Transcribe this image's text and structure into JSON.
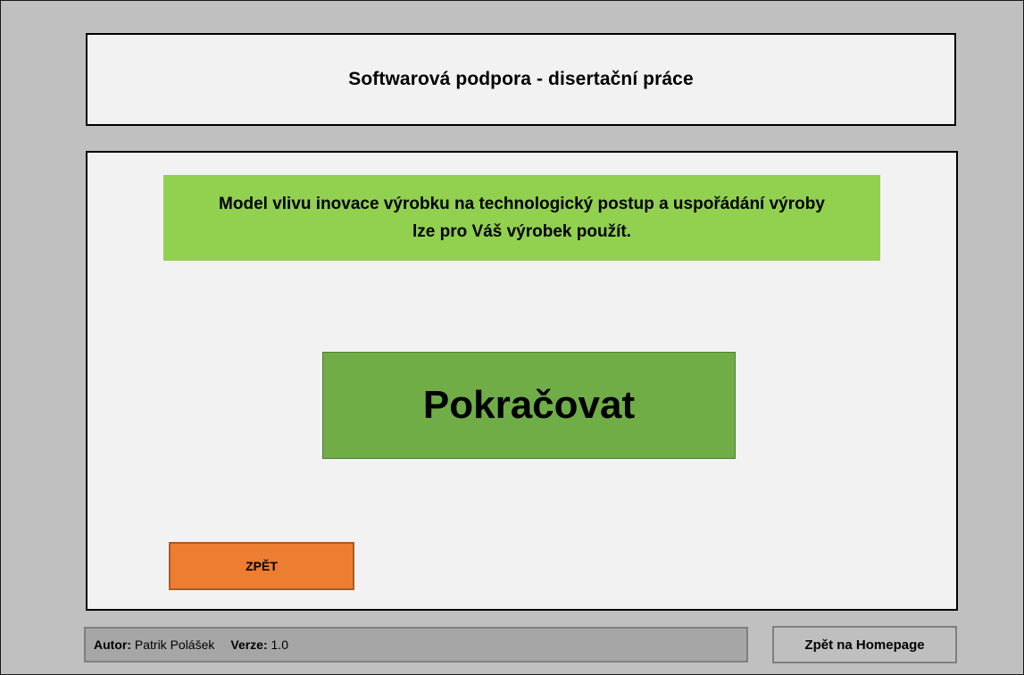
{
  "header": {
    "title": "Softwarová podpora - disertační práce"
  },
  "main": {
    "message_line_1": "Model vlivu inovace výrobku na technologický postup a uspořádání výroby",
    "message_line_2": "lze pro Váš výrobek použít.",
    "continue_label": "Pokračovat",
    "back_label": "ZPĚT"
  },
  "footer": {
    "author_key": "Autor:",
    "author_value": "Patrik Polášek",
    "version_key": "Verze:",
    "version_value": "1.0",
    "homepage_label": "Zpět na Homepage"
  },
  "colors": {
    "background": "#c0c0c0",
    "panel": "#f2f2f2",
    "message_banner": "#92d050",
    "continue_button": "#70ad47",
    "back_button": "#ed7d31",
    "footer_info": "#a6a6a6",
    "homepage_button": "#bfbfbf"
  }
}
